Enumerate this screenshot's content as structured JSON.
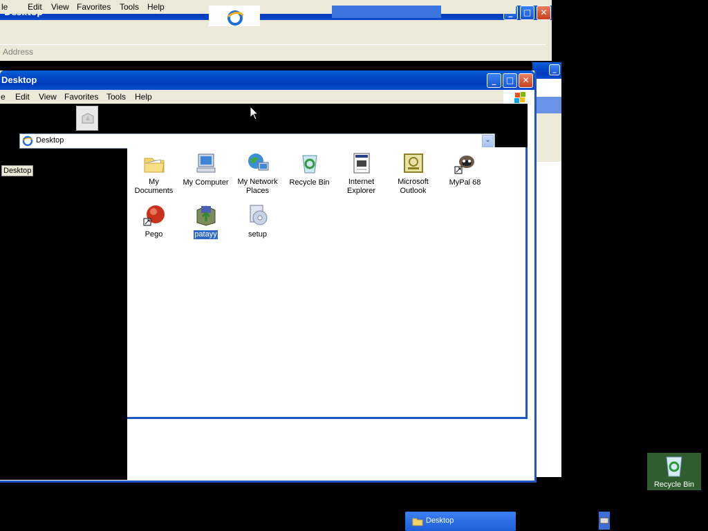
{
  "back_window": {
    "title": "Desktop",
    "menu": [
      "le",
      "Edit",
      "View",
      "Favorites",
      "Tools",
      "Help"
    ],
    "address_label": "Address"
  },
  "main_window": {
    "title": "Desktop",
    "menu": [
      "e",
      "Edit",
      "View",
      "Favorites",
      "Tools",
      "Help"
    ],
    "address_value": "Desktop",
    "side_label": "Desktop",
    "icons": [
      {
        "label": "My Documents",
        "icon": "folder-documents-icon",
        "selected": false
      },
      {
        "label": "My Computer",
        "icon": "computer-icon",
        "selected": false
      },
      {
        "label": "My Network Places",
        "icon": "network-places-icon",
        "selected": false
      },
      {
        "label": "Recycle Bin",
        "icon": "recycle-bin-icon",
        "selected": false
      },
      {
        "label": "Internet Explorer",
        "icon": "internet-explorer-icon",
        "selected": false
      },
      {
        "label": "Microsoft Outlook",
        "icon": "outlook-icon",
        "selected": false
      },
      {
        "label": "MyPal 68",
        "icon": "mypal-icon",
        "selected": false
      },
      {
        "label": "Pego",
        "icon": "pego-icon",
        "selected": false
      },
      {
        "label": "patayy",
        "icon": "package-icon",
        "selected": true
      },
      {
        "label": "setup",
        "icon": "setup-icon",
        "selected": false
      }
    ]
  },
  "taskbar": {
    "button_label": "Desktop"
  },
  "desktop": {
    "recycle_label": "Recycle Bin"
  },
  "colors": {
    "xp_blue": "#0046c8",
    "selection": "#316ac5",
    "menu_bg": "#ece9d8"
  }
}
